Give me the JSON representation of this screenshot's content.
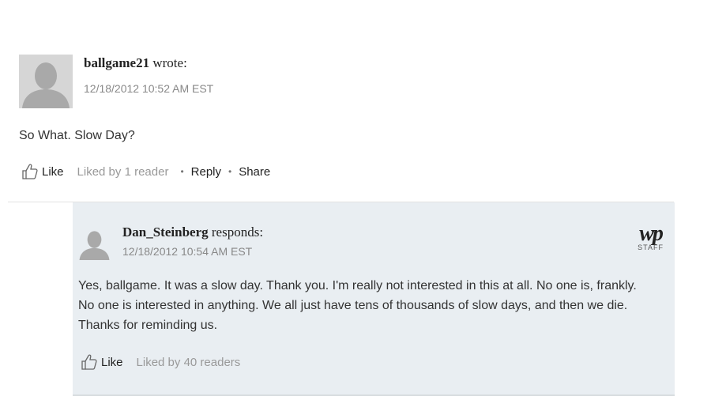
{
  "comment": {
    "author": "ballgame21",
    "verb": "wrote:",
    "timestamp": "12/18/2012 10:52 AM EST",
    "text": "So What. Slow Day?",
    "like_label": "Like",
    "liked_by": "Liked by 1 reader",
    "reply_label": "Reply",
    "share_label": "Share"
  },
  "response": {
    "author": "Dan_Steinberg",
    "verb": "responds:",
    "timestamp": "12/18/2012 10:54 AM EST",
    "text": "Yes, ballgame. It was a slow day. Thank you. I'm really not interested in this at all. No one is, frankly. No one is interested in anything. We all just have tens of thousands of slow days, and then we die. Thanks for reminding us.",
    "like_label": "Like",
    "liked_by": "Liked by 40 readers",
    "badge_mark": "wp",
    "badge_label": "STAFF"
  },
  "icons": {
    "avatar": "default-avatar-icon",
    "like": "thumbs-up-icon"
  },
  "colors": {
    "reply_background": "#e9eef2",
    "muted_text": "#999999",
    "avatar_bg": "#d6d6d6"
  }
}
